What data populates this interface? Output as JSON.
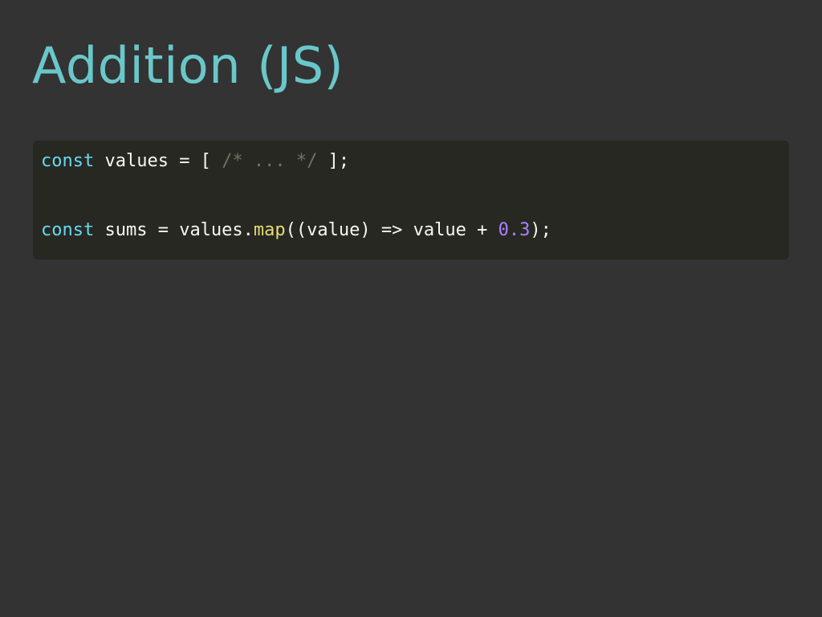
{
  "slide": {
    "title": "Addition (JS)"
  },
  "code": {
    "lines": [
      {
        "tokens": [
          {
            "type": "keyword",
            "text": "const"
          },
          {
            "type": "plain",
            "text": " values = [ "
          },
          {
            "type": "comment",
            "text": "/* ... */"
          },
          {
            "type": "plain",
            "text": " ];"
          }
        ]
      },
      {
        "tokens": [
          {
            "type": "keyword",
            "text": "const"
          },
          {
            "type": "plain",
            "text": " sums = values."
          },
          {
            "type": "func",
            "text": "map"
          },
          {
            "type": "plain",
            "text": "((value) => value + "
          },
          {
            "type": "number",
            "text": "0.3"
          },
          {
            "type": "plain",
            "text": ");"
          }
        ]
      }
    ]
  },
  "colors": {
    "background": "#333333",
    "title": "#6ac7c9",
    "code_background": "#272822",
    "keyword": "#66d9ef",
    "plain": "#f8f8f2",
    "comment": "#75715e",
    "function": "#e6db74",
    "number": "#ae81ff"
  }
}
